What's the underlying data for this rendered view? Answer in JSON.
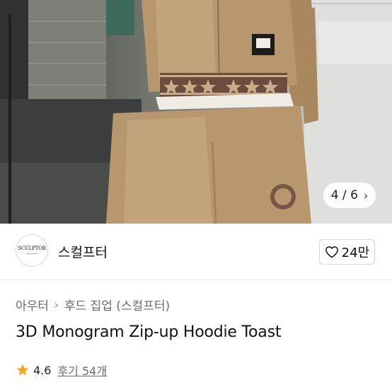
{
  "gallery": {
    "current": "4",
    "separator": "/",
    "total": "6",
    "next_icon": "chevron-right-icon"
  },
  "brand": {
    "logo_text": "SCULPTOR",
    "name": "스컬프터",
    "likes": "24만",
    "like_icon": "heart-outline-icon"
  },
  "breadcrumb": {
    "items": [
      "아우터",
      "후드 집업 (스컬프터)"
    ],
    "separator_icon": "chevron-right-icon"
  },
  "product": {
    "title": "3D Monogram Zip-up Hoodie Toast"
  },
  "rating": {
    "score": "4.6",
    "reviews": "후기 54개",
    "star_color": "#F5A623"
  },
  "colors": {
    "garment": "#B8976F",
    "stripe": "#6E4B3E"
  }
}
